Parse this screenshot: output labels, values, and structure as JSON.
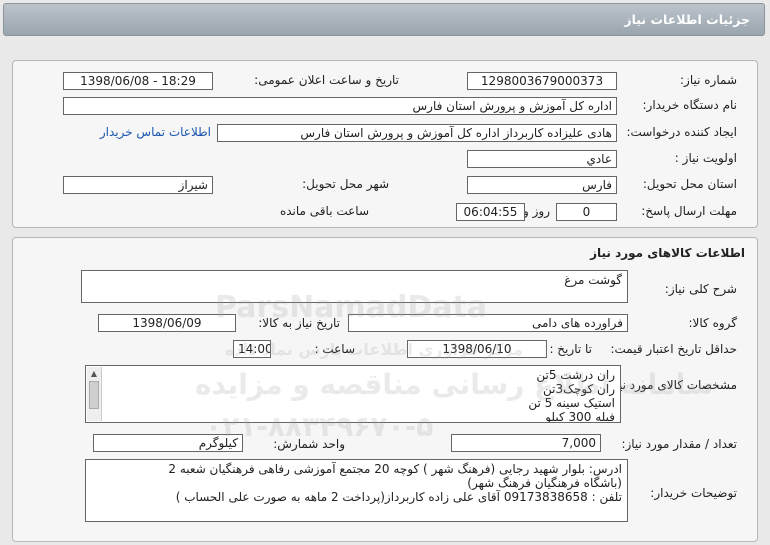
{
  "header": {
    "title": "جزئیات اطلاعات نیاز"
  },
  "details": {
    "need_number_label": "شماره نیاز:",
    "need_number": "1298003679000373",
    "announce_label": "تاریخ و ساعت اعلان عمومی:",
    "announce_value": "1398/06/08 - 18:29",
    "buyer_label": "نام دستگاه خریدار:",
    "buyer_value": "اداره کل آموزش و پرورش استان فارس",
    "creator_label": "ایجاد کننده درخواست:",
    "creator_value": "هادی علیزاده کاربرداز اداره کل آموزش و پرورش استان فارس",
    "contact_link": "اطلاعات تماس خریدار",
    "priority_label": "اولویت نیاز :",
    "priority_value": "عادي",
    "province_label": "استان محل تحویل:",
    "province_value": "فارس",
    "city_label": "شهر محل تحویل:",
    "city_value": "شیراز",
    "deadline_label": "مهلت ارسال پاسخ:",
    "deadline_days": "0",
    "days_word": "روز و",
    "deadline_time": "06:04:55",
    "remaining_label": "ساعت باقی مانده"
  },
  "goods": {
    "section_title": "اطلاعات کالاهای مورد نیاز",
    "desc_label": "شرح کلی نیاز:",
    "desc_value": "گوشت مرغ",
    "group_label": "گروه کالا:",
    "group_value": "فراورده های دامی",
    "need_date_label": "تاریخ نیاز به کالا:",
    "need_date": "1398/06/09",
    "validity_label": "حداقل تاریخ اعتبار قیمت:",
    "until_label": "تا تاریخ :",
    "validity_date": "1398/06/10",
    "hour_label": "ساعت :",
    "validity_time": "14:00",
    "specs_label": "مشخصات کالای مورد نیاز:",
    "specs_lines": [
      "ران درشت  5تن",
      "ران کوچک3تن",
      "استیک سینه 5 تن",
      "فیله 300 کیلو"
    ],
    "qty_label": "تعداد / مقدار مورد نیاز:",
    "qty_value": "7,000",
    "unit_label": "واحد شمارش:",
    "unit_value": "کیلوگرم",
    "notes_label": "توضیحات خریدار:",
    "notes_lines": [
      "ادرس: بلوار شهید رجایی (فرهنگ شهر ) کوچه 20  مجتمع آموزشی رفاهی فرهنگیان شعبه 2",
      "(باشگاه فرهنگیان فرهنگ شهر)",
      "تلفن : 09173838658 آقای علی زاده کاربرداز(پرداخت 2 ماهه به صورت علی الحساب )"
    ]
  },
  "watermark": {
    "brand": "ParsNamadData",
    "line1": "مرکز فراوری اطلاعات پارس نماد داده",
    "line2": "سامانه اطلاع رسانی مناقصه و مزایده",
    "phone": "۰۲۱-۸۸۳۴۹۶۷۰-۵"
  }
}
